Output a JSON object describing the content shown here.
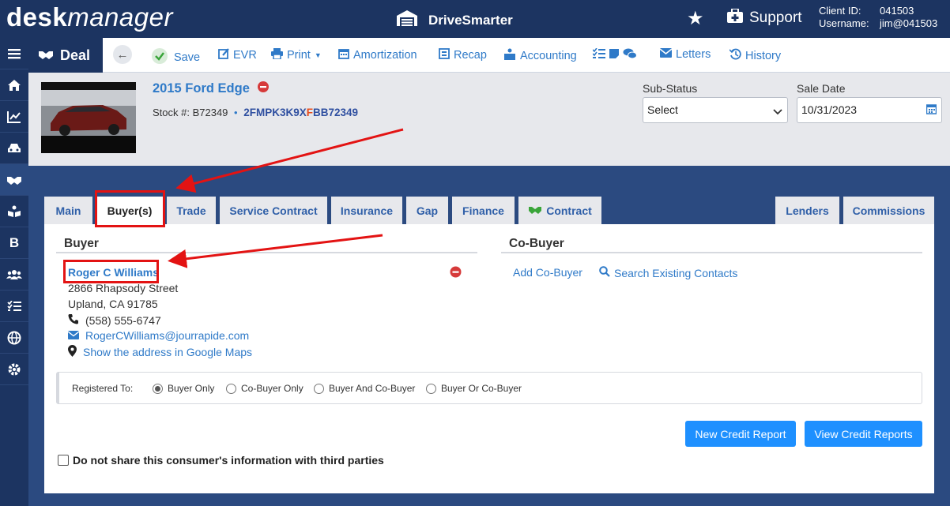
{
  "header": {
    "logo_bold": "desk",
    "logo_italic": "manager",
    "brand": "DriveSmarter",
    "support": "Support",
    "client_id_label": "Client ID:",
    "client_id": "041503",
    "username_label": "Username:",
    "username": "jim@041503"
  },
  "sidebar": {
    "items": [
      "menu-icon",
      "home-icon",
      "chart-icon",
      "car-icon",
      "handshake-icon",
      "book-icon",
      "b-icon",
      "users-icon",
      "list-icon",
      "globe-icon",
      "gear-icon"
    ],
    "b_label": "B"
  },
  "toolbar": {
    "deal": "Deal",
    "save": "Save",
    "evr": "EVR",
    "print": "Print",
    "amortization": "Amortization",
    "recap": "Recap",
    "accounting": "Accounting",
    "letters": "Letters",
    "history": "History"
  },
  "vehicle": {
    "title": "2015 Ford Edge",
    "stock_label": "Stock #:",
    "stock": "B72349",
    "vin_a": "2FMPK3K9X",
    "vin_b": "F",
    "vin_c": "BB72349",
    "sub_status_label": "Sub-Status",
    "sub_status_value": "Select",
    "sale_date_label": "Sale Date",
    "sale_date_value": "10/31/2023"
  },
  "tabs": {
    "main": "Main",
    "buyers": "Buyer(s)",
    "trade": "Trade",
    "service_contract": "Service Contract",
    "insurance": "Insurance",
    "gap": "Gap",
    "finance": "Finance",
    "contract": "Contract",
    "lenders": "Lenders",
    "commissions": "Commissions"
  },
  "buyer": {
    "section": "Buyer",
    "name": "Roger C Williams",
    "street": "2866 Rhapsody Street",
    "city": "Upland, CA 91785",
    "phone": "(558) 555-6747",
    "email": "RogerCWilliams@jourrapide.com",
    "maps": "Show the address in Google Maps"
  },
  "cobuyer": {
    "section": "Co-Buyer",
    "add": "Add Co-Buyer",
    "search": "Search Existing Contacts"
  },
  "registered": {
    "label": "Registered To:",
    "options": [
      "Buyer Only",
      "Co-Buyer Only",
      "Buyer And Co-Buyer",
      "Buyer Or Co-Buyer"
    ],
    "selected": "Buyer Only"
  },
  "actions": {
    "new_credit_report": "New Credit Report",
    "view_credit_reports": "View Credit Reports",
    "do_not_share": "Do not share this consumer's information with third parties"
  },
  "colors": {
    "navy": "#1c3461",
    "accent_blue": "#2f7ac8",
    "button_blue": "#1e90ff",
    "annotation_red": "#e31313"
  }
}
